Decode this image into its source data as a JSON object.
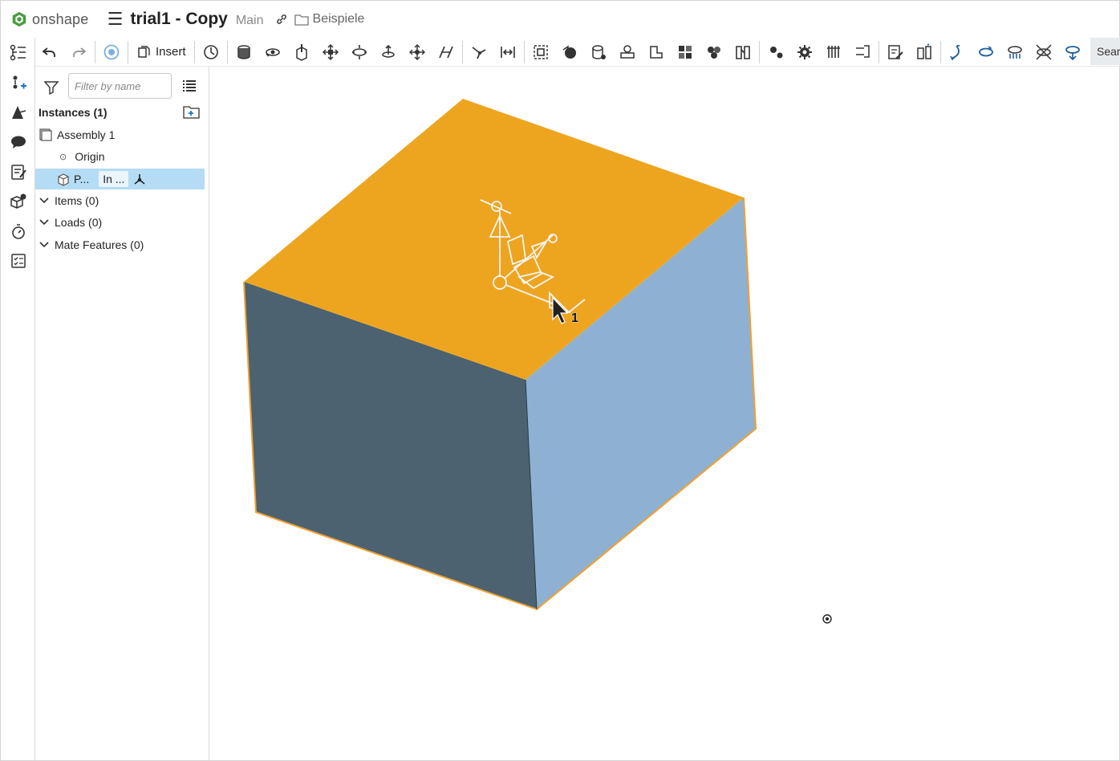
{
  "header": {
    "logo_text": "onshape",
    "document_title": "trial1 - Copy",
    "branch": "Main",
    "folder": "Beispiele"
  },
  "toolbar": {
    "insert_label": "Insert",
    "search_label": "Sear"
  },
  "panel": {
    "filter_placeholder": "Filter by name",
    "instances_title": "Instances (1)",
    "tree": {
      "assembly": "Assembly 1",
      "origin": "Origin",
      "part_label": "P...",
      "part_badge": "In ..."
    },
    "groups": {
      "items": "Items (0)",
      "loads": "Loads (0)",
      "mate_features": "Mate Features (0)"
    }
  },
  "viewport": {
    "cursor_badge": "1"
  },
  "colors": {
    "top_face": "#EDA520",
    "left_face": "#4C6270",
    "right_face": "#8EB1D3",
    "edge_highlight": "#F0A030",
    "selection": "#B4DCF5",
    "accent": "#1A73C9"
  }
}
